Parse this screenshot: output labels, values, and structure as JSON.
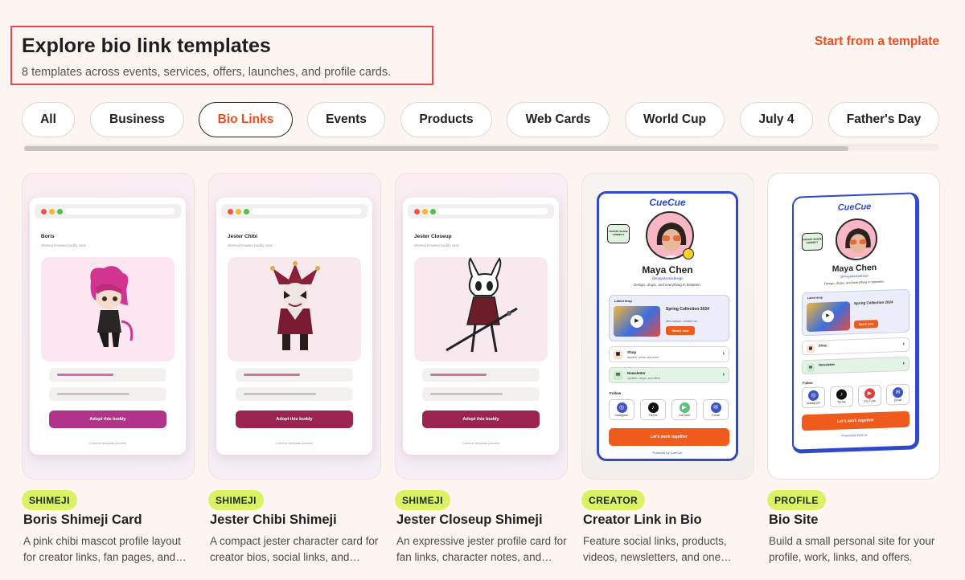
{
  "header": {
    "title": "Explore bio link templates",
    "subtitle": "8 templates across events, services, offers, launches, and profile cards.",
    "start_link": "Start from a template"
  },
  "filters": [
    "All",
    "Business",
    "Bio Links",
    "Events",
    "Products",
    "Web Cards",
    "World Cup",
    "July 4",
    "Father's Day"
  ],
  "active_filter": "Bio Links",
  "colors": {
    "accent": "#ec4e1f",
    "tag_bg": "#dbf265",
    "page_bg": "#fdf5f1",
    "creator_blue": "#2f49c9"
  },
  "cards": [
    {
      "tag": "SHIMEJI",
      "title": "Boris Shimeji Card",
      "desc": "A pink chibi mascot profile layout for creator links, fan pages, and…",
      "preview": {
        "name": "Boris",
        "sub": "Shimeji browser buddy card",
        "button": "Adopt this buddy",
        "footer": "CueCue template preview",
        "button_color": "#b2338a"
      }
    },
    {
      "tag": "SHIMEJI",
      "title": "Jester Chibi Shimeji",
      "desc": "A compact jester character card for creator bios, social links, and…",
      "preview": {
        "name": "Jester Chibi",
        "sub": "Shimeji browser buddy card",
        "button": "Adopt this buddy",
        "footer": "CueCue template preview",
        "button_color": "#9b2550"
      }
    },
    {
      "tag": "SHIMEJI",
      "title": "Jester Closeup Shimeji",
      "desc": "An expressive jester profile card for fan links, character notes, and…",
      "preview": {
        "name": "Jester Closeup",
        "sub": "Shimeji browser buddy card",
        "button": "Adopt this buddy",
        "footer": "CueCue template preview",
        "button_color": "#9b2550"
      }
    },
    {
      "tag": "CREATOR",
      "title": "Creator Link in Bio",
      "desc": "Feature social links, products, videos, newsletters, and one…",
      "preview": {
        "brand": "CueCue",
        "sticker": "CREATE SHARE CONNECT",
        "name": "Maya Chen",
        "handle": "@mayalovesdesign",
        "tagline": "Design, drops, and everything in between.",
        "drop_label": "Latest drop",
        "drop_title": "Spring Collection 2024",
        "drop_note": "New season. Limited run.",
        "drop_button": "Watch now",
        "shop_title": "Shop",
        "shop_sub": "Apparel, prints, and more",
        "news_title": "Newsletter",
        "news_sub": "Updates, drops, and offers",
        "follow_label": "Follow",
        "socials": [
          "Instagram",
          "TikTok",
          "YouTube",
          "Email"
        ],
        "cta": "Let's work together",
        "powered": "Powered by CueCue"
      }
    },
    {
      "tag": "PROFILE",
      "title": "Bio Site",
      "desc": "Build a small personal site for your profile, work, links, and offers."
    }
  ]
}
